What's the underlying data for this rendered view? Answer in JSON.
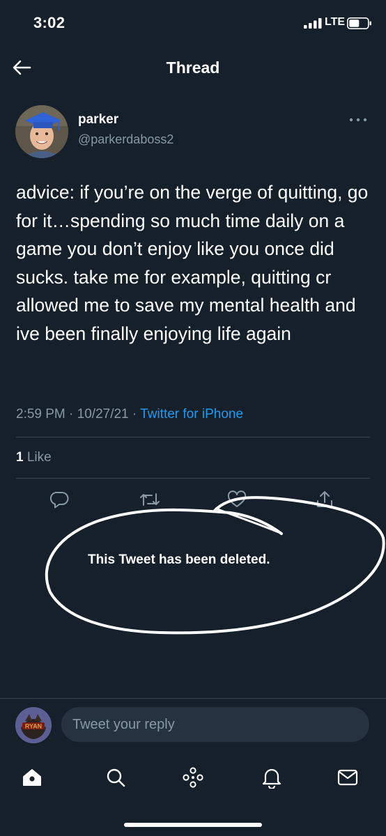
{
  "status_bar": {
    "time": "3:02",
    "network": "LTE",
    "icons": [
      "signal-bars-icon",
      "battery-icon"
    ]
  },
  "header": {
    "title": "Thread",
    "back_icon": "arrow-left-icon"
  },
  "tweet": {
    "display_name": "parker",
    "handle": "@parkerdaboss2",
    "text": "advice: if you’re on the verge of quitting, go for it…spending so much time daily on a game you don’t enjoy like you once did sucks. take me for example, quitting cr allowed me to save my mental health and ive been finally enjoying life again",
    "time": "2:59 PM",
    "date": "10/27/21",
    "source": "Twitter for iPhone",
    "like_count": "1",
    "like_label": "Like",
    "actions": [
      "reply-icon",
      "retweet-icon",
      "like-icon",
      "share-icon"
    ]
  },
  "deleted_notice": {
    "text": "This Tweet has been deleted."
  },
  "reply_bar": {
    "placeholder": "Tweet your reply",
    "avatar_text": "RYAN"
  },
  "bottom_nav": {
    "items": [
      "home-icon",
      "search-icon",
      "spaces-icon",
      "notifications-icon",
      "messages-icon"
    ]
  },
  "colors": {
    "background": "#15202b",
    "accent": "#1d9bf0",
    "secondary_text": "#8899a6",
    "divider": "#38444d",
    "input_bg": "#253341"
  }
}
